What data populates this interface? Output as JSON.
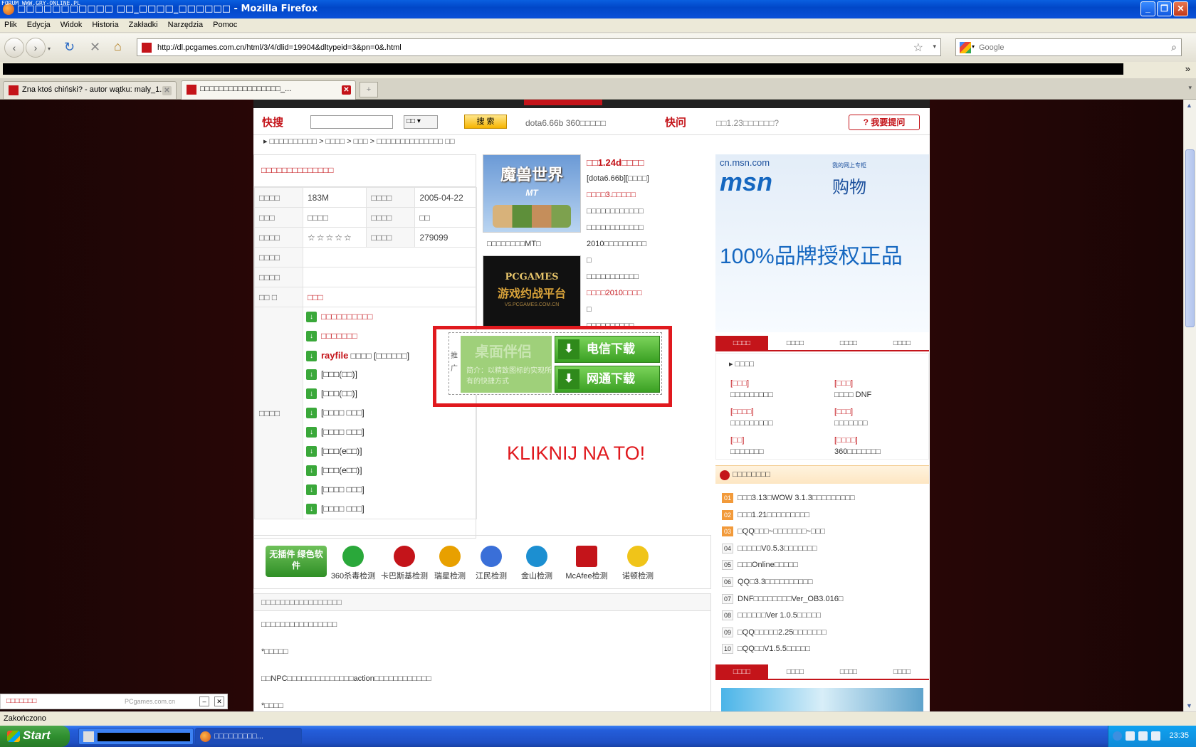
{
  "window": {
    "forum_watermark": "FORUM WWW.GRY-ONLINE.PL",
    "title": "□□□□□□□□□□□ □□_□□□□_□□□□□□ - Mozilla Firefox",
    "btn_min": "_",
    "btn_max": "❐",
    "btn_close": "✕"
  },
  "menu": [
    "Plik",
    "Edycja",
    "Widok",
    "Historia",
    "Zakładki",
    "Narzędzia",
    "Pomoc"
  ],
  "nav": {
    "url": "http://dl.pcgames.com.cn/html/3/4/dlid=19904&dltypeid=3&pn=0&.html",
    "search_placeholder": "Google"
  },
  "tabs": [
    {
      "label": "Zna ktoś chiński? - autor wątku: maly_1...",
      "active": false
    },
    {
      "label": "□□□□□□□□□□□□□□□□□_...",
      "active": true
    }
  ],
  "page": {
    "kuaisou_label": "快搜",
    "kuaisou_select": "□□",
    "search_btn": "搜 索",
    "hot_keywords": "dota6.66b 360□□□□□",
    "kuaiwen_label": "快问",
    "kuaiwen_text": "□□1.23□□□□□□?",
    "ask_btn": "我要提问",
    "breadcrumb": "▸ □□□□□□□□□□ > □□□□ > □□□ > □□□□□□□□□□□□□□ □□",
    "info_title": "□□□□□□□□□□□□□□",
    "info": {
      "size_label": "□□□□",
      "size": "183M",
      "date_label": "□□□□",
      "date": "2005-04-22",
      "lang_label": "□□□",
      "lang": "□□□□",
      "type_label": "□□□□",
      "type": "□□",
      "rating_label": "□□□□",
      "rating": "☆☆☆☆☆",
      "downloads_label": "□□□□",
      "downloads": "279099",
      "env_label": "□□□□",
      "env": "",
      "auth_label": "□□□□",
      "auth": "",
      "links_label": "□□ □",
      "links": "□□□",
      "dl_label": "□□□□"
    },
    "downloads": [
      {
        "text": "□□□□□□□□□□",
        "red": true
      },
      {
        "text": "□□□□□□□",
        "red": true
      },
      {
        "text_bold": "rayfile",
        "text": "□□□□ [□□□□□□]",
        "red": false
      },
      {
        "text": "[□□□(□□)]",
        "red": false
      },
      {
        "text": "[□□□(□□)]",
        "red": false
      },
      {
        "text": "[□□□□ □□□]",
        "red": false
      },
      {
        "text": "[□□□□ □□□]",
        "red": false
      },
      {
        "text": "[□□□(e□□)]",
        "red": false
      },
      {
        "text": "[□□□(e□□)]",
        "red": false
      },
      {
        "text": "[□□□□ □□□]",
        "red": false
      },
      {
        "text": "[□□□□ □□□]",
        "red": false
      }
    ],
    "thumb1": {
      "title": "魔兽世界",
      "sub": "MT",
      "caption": "□□□□□□□□MT□"
    },
    "thumb2": {
      "a": "PCGAMES",
      "b": "游戏约战平台",
      "c": "VS.PCGAMES.COM.CN"
    },
    "news": [
      {
        "text": "□□1.24d□□□□",
        "hl": true
      },
      {
        "text": "[dota6.66b][□□□□]",
        "hl": false
      },
      {
        "text": "□□□□3.□□□□□",
        "hl": false
      },
      {
        "text": "□□□□□□□□□□□□",
        "hl": false
      },
      {
        "text": "□□□□□□□□□□□□",
        "hl": false
      },
      {
        "text": "2010□□□□□□□□□",
        "hl": false
      },
      {
        "text": "□",
        "hl": false
      },
      {
        "text": "□□□□□□□□□□□",
        "hl": false
      },
      {
        "text": "□□□□2010□□□□",
        "hl": false
      },
      {
        "text": "□",
        "hl": false
      },
      {
        "text": "□□□□□□□□□□",
        "hl": false
      }
    ],
    "promo": {
      "side_label": "推广",
      "app_name": "桌面伴侣",
      "desc": "简介：以精致图标的实现所有的快捷方式",
      "btn1": "电信下载",
      "btn2": "网通下载"
    },
    "annotation": "KLIKNIJ NA TO!",
    "security": {
      "badge": "无插件 绿色软件",
      "items": [
        "360杀毒检测",
        "卡巴斯基检测",
        "瑞星检测",
        "江民检测",
        "金山检测",
        "McAfee检测",
        "诺顿检测"
      ],
      "icon_names": [
        "360-icon",
        "kaspersky-icon",
        "rising-icon",
        "jiangmin-icon",
        "kingsoft-icon",
        "mcafee-icon",
        "norton-icon"
      ]
    },
    "bottom": {
      "header": "□□□□□□□□□□□□□□□□□",
      "line1": "□□□□□□□□□□□□□□□□",
      "line2": "*□□□□□",
      "line3": "□□NPC□□□□□□□□□□□□□□action□□□□□□□□□□□□",
      "line4": "*□□□□"
    },
    "ad": {
      "domain": "cn.msn.com",
      "brand": "msn",
      "sub": "我的网上专柜",
      "word": "购物",
      "slogan": "100%品牌授权正品"
    },
    "right_tabs": [
      "□□□□",
      "□□□□",
      "□□□□",
      "□□□□"
    ],
    "right_head": "□□□□",
    "right_grid": [
      {
        "t": "[□□□]",
        "r": true
      },
      {
        "t": "[□□□]",
        "r": true
      },
      {
        "t": "□□□□□□□□□",
        "r": false
      },
      {
        "t": "□□□□ DNF",
        "r": false
      },
      {
        "t": "[□□□□]",
        "r": true
      },
      {
        "t": "[□□□]",
        "r": true
      },
      {
        "t": "□□□□□□□□□",
        "r": false
      },
      {
        "t": "□□□□□□□",
        "r": false
      },
      {
        "t": "[□□]",
        "r": true
      },
      {
        "t": "[□□□□]",
        "r": true
      },
      {
        "t": "□□□□□□□",
        "r": false
      },
      {
        "t": "360□□□□□□□",
        "r": false
      }
    ],
    "rank_title": "□□□□□□□□",
    "rank": [
      {
        "n": "01",
        "t": "□□□3.13□WOW 3.1.3□□□□□□□□□"
      },
      {
        "n": "02",
        "t": "□□□1.21□□□□□□□□□"
      },
      {
        "n": "03",
        "t": "□QQ□□□~□□□□□□□~□□□"
      },
      {
        "n": "04",
        "t": "□□□□□V0.5.3□□□□□□□"
      },
      {
        "n": "05",
        "t": "□□□Online□□□□□"
      },
      {
        "n": "06",
        "t": "QQ□3.3□□□□□□□□□□"
      },
      {
        "n": "07",
        "t": "DNF□□□□□□□□Ver_OB3.016□"
      },
      {
        "n": "08",
        "t": "□□□□□□Ver 1.0.5□□□□□"
      },
      {
        "n": "09",
        "t": "□QQ□□□□□2.25□□□□□□□"
      },
      {
        "n": "10",
        "t": "□QQ□□V1.5.5□□□□□"
      }
    ],
    "right_tabs2": [
      "□□□□",
      "□□□□",
      "□□□□",
      "□□□□"
    ]
  },
  "minibar": {
    "left": "□□□□□□□",
    "center": "PCgames.com.cn",
    "min": "–",
    "close": "✕"
  },
  "status": "Zakończono",
  "taskbar": {
    "start": "Start",
    "task2": "□□□□□□□□□...",
    "time": "23:35"
  }
}
